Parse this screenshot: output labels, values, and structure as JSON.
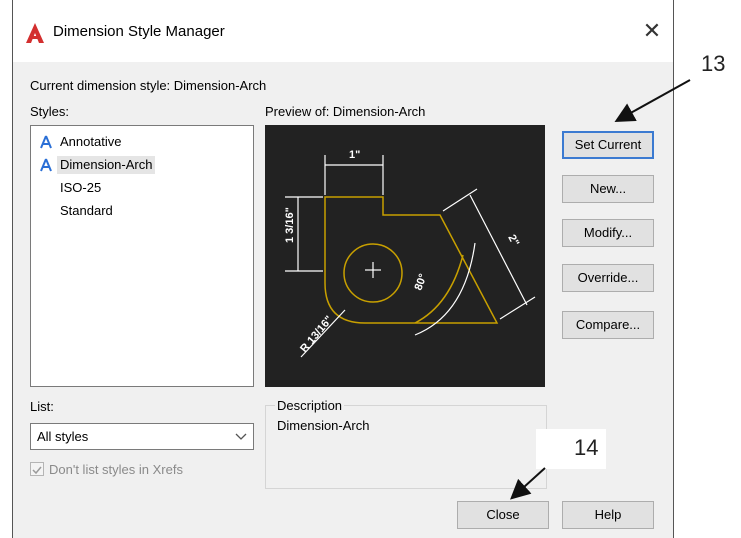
{
  "window": {
    "title": "Dimension Style Manager"
  },
  "current_style": "Current dimension style: Dimension-Arch",
  "styles": {
    "label": "Styles:",
    "items": [
      {
        "label": "Annotative",
        "icon": "annotative-icon"
      },
      {
        "label": "Dimension-Arch",
        "icon": "annotative-icon",
        "selected": true
      },
      {
        "label": "ISO-25"
      },
      {
        "label": "Standard"
      }
    ]
  },
  "preview": {
    "label": "Preview of: Dimension-Arch",
    "dims": [
      "1\"",
      "1 3/16\"",
      "2\"",
      "80°",
      "R 13/16\""
    ]
  },
  "buttons": {
    "set_current": "Set Current",
    "new": "New...",
    "modify": "Modify...",
    "override": "Override...",
    "compare": "Compare...",
    "close": "Close",
    "help": "Help"
  },
  "list": {
    "label": "List:",
    "selected": "All styles"
  },
  "xrefs_checkbox": {
    "label": "Don't list styles in Xrefs",
    "checked": true
  },
  "description": {
    "title": "Description",
    "text": "Dimension-Arch"
  },
  "callouts": [
    "13",
    "14"
  ],
  "colors": {
    "accent": "#3b7ad1",
    "geometry": "#c8a000",
    "preview_bg": "#222222",
    "app_icon": "#d32f2f"
  }
}
